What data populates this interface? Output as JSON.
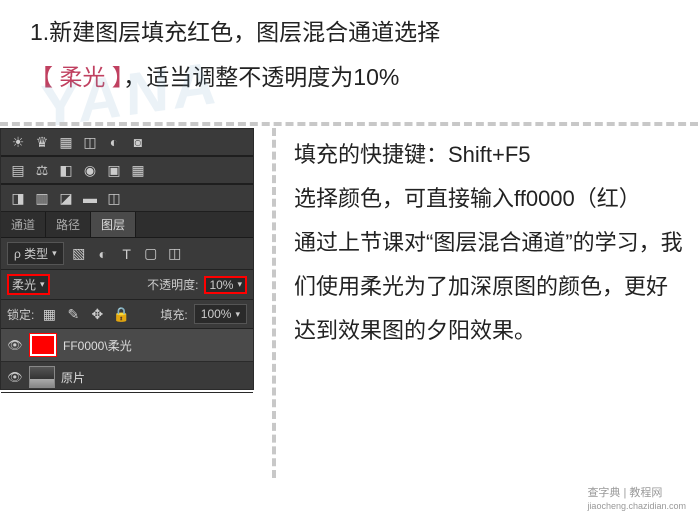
{
  "main": {
    "line1_prefix": "1.新建图层填充红色，图层混合通道选择",
    "line2_hl": "【 柔光 】",
    "line2_rest": "，适当调整不透明度为10%"
  },
  "panel": {
    "tabs": {
      "t1": "通道",
      "t2": "路径",
      "t3": "图层"
    },
    "kind_label": "ρ 类型",
    "blend_mode": "柔光",
    "opacity_label": "不透明度:",
    "opacity_value": "10%",
    "lock_label": "锁定:",
    "fill_label": "填充:",
    "fill_value": "100%",
    "layer1": "FF0000\\柔光",
    "layer2": "原片"
  },
  "side": {
    "p1": "填充的快捷键：Shift+F5",
    "p2": "选择颜色，可直接输入ff0000（红）",
    "p3": "通过上节课对“图层混合通道”的学习，我们使用柔光为了加深原图的颜色，更好达到效果图的夕阳效果。"
  },
  "footer": {
    "site": "查字典 | 教程网",
    "url": "jiaocheng.chazidian.com"
  }
}
